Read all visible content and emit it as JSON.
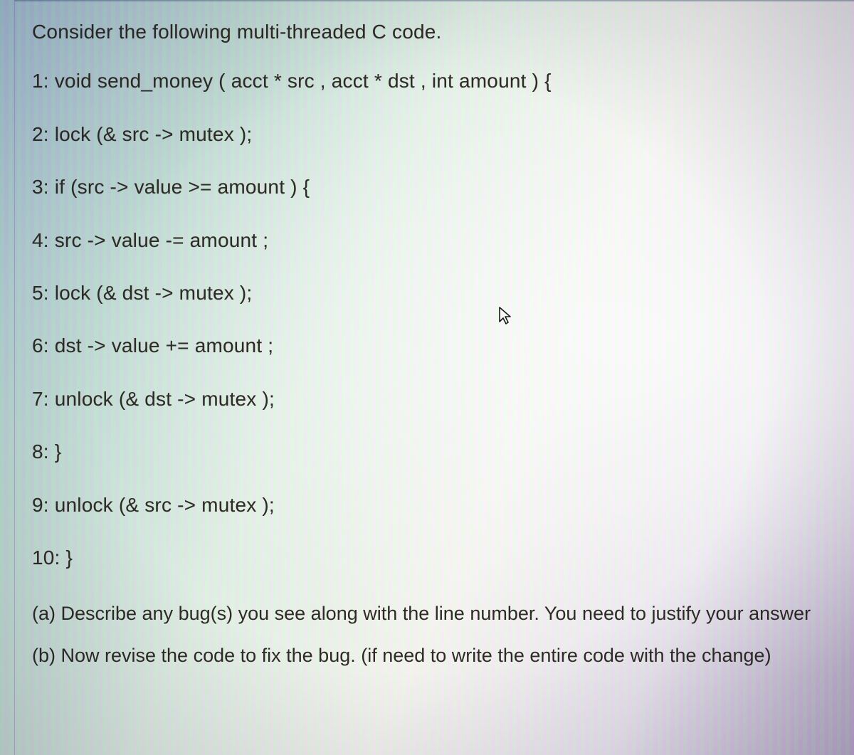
{
  "intro": "Consider the following multi-threaded C code.",
  "code": {
    "l1": "1: void send_money ( acct * src , acct * dst , int amount ) {",
    "l2": "2: lock (& src -> mutex );",
    "l3": "3: if (src -> value >= amount ) {",
    "l4": "4: src -> value -= amount ;",
    "l5": "5: lock (& dst -> mutex );",
    "l6": "6: dst -> value += amount ;",
    "l7": "7: unlock (& dst -> mutex );",
    "l8": "8: }",
    "l9": "9: unlock (& src -> mutex );",
    "l10": "10: }"
  },
  "questions": {
    "a": "(a) Describe any bug(s) you see along with the line number. You need to justify your answer",
    "b": "(b) Now revise the code to fix the bug. (if need to write the entire code with the change)"
  }
}
